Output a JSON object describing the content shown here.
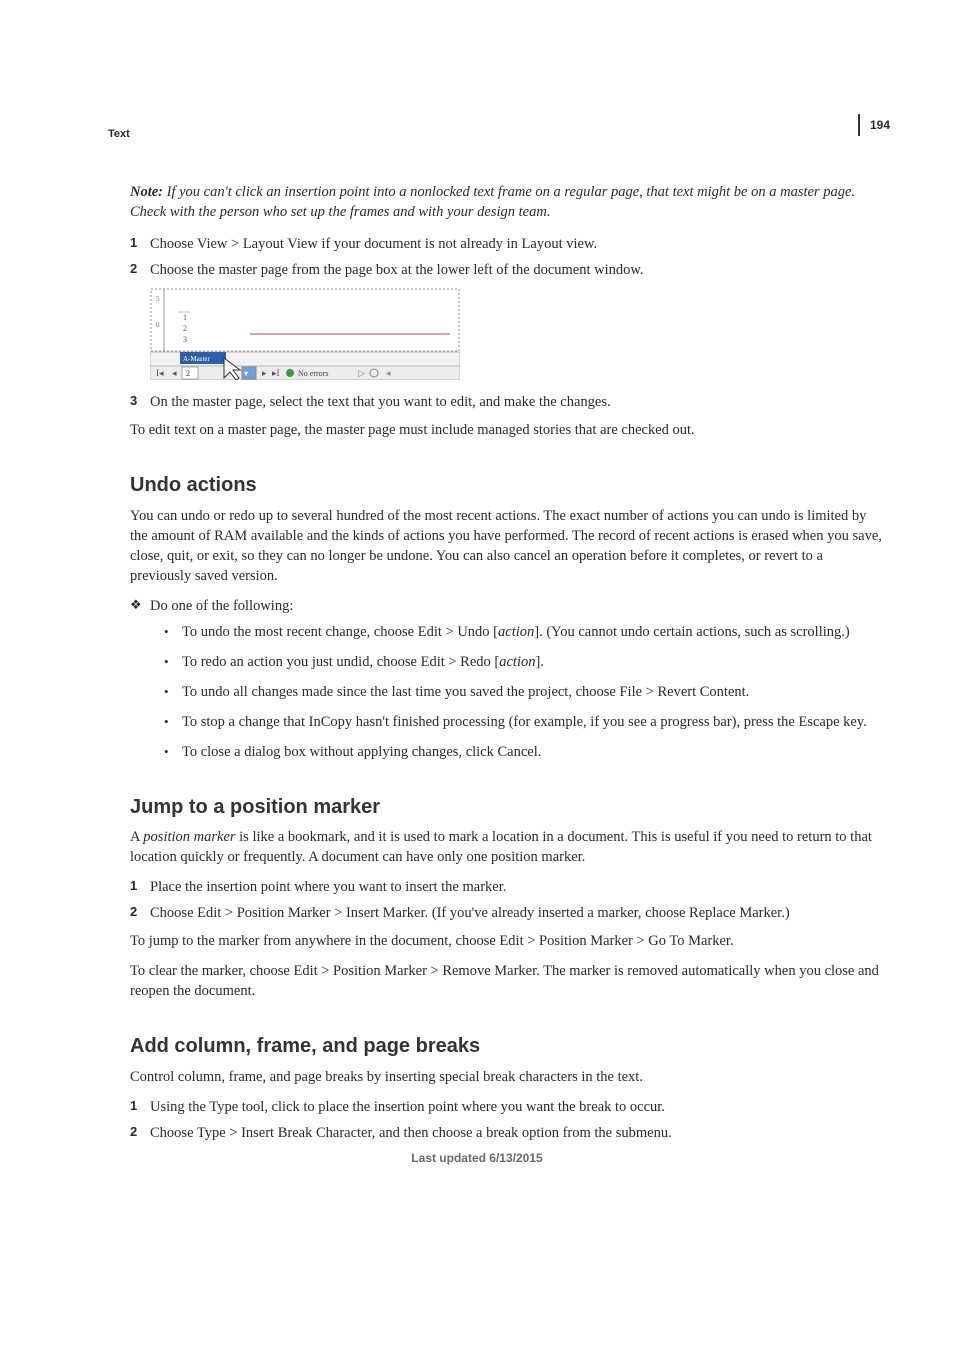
{
  "header_label": "Text",
  "page_number": "194",
  "note_prefix": "Note:",
  "note_body": " If you can't click an insertion point into a nonlocked text frame on a regular page, that text might be on a master page. Check with the person who set up the frames and with your design team.",
  "top_steps": [
    "Choose View > Layout View if your document is not already in Layout view.",
    "Choose the master page from the page box at the lower left of the document window."
  ],
  "figure": {
    "rows": [
      "1",
      "2",
      "3"
    ],
    "tab_label": "A-Master",
    "page_field": "2",
    "status": "No errors"
  },
  "step3": "On the master page, select the text that you want to edit, and make the changes.",
  "master_edit_note": "To edit text on a master page, the master page must include managed stories that are checked out.",
  "undo": {
    "title": "Undo actions",
    "body": "You can undo or redo up to several hundred of the most recent actions. The exact number of actions you can undo is limited by the amount of RAM available and the kinds of actions you have performed. The record of recent actions is erased when you save, close, quit, or exit, so they can no longer be undone. You can also cancel an operation before it completes, or revert to a previously saved version.",
    "do_one": "Do one of the following:",
    "items": {
      "a_pre": "To undo the most recent change, choose Edit > Undo [",
      "a_em": "action",
      "a_post": "]. (You cannot undo certain actions, such as scrolling.)",
      "b_pre": "To redo an action you just undid, choose Edit > Redo [",
      "b_em": "action",
      "b_post": "].",
      "c": "To undo all changes made since the last time you saved the project, choose File > Revert Content.",
      "d": "To stop a change that InCopy hasn't finished processing (for example, if you see a progress bar), press the Escape key.",
      "e": "To close a dialog box without applying changes, click Cancel."
    }
  },
  "jump": {
    "title": "Jump to a position marker",
    "body_pre": "A ",
    "body_em": "position marker",
    "body_post": " is like a bookmark, and it is used to mark a location in a document. This is useful if you need to return to that location quickly or frequently. A document can have only one position marker.",
    "steps": [
      "Place the insertion point where you want to insert the marker.",
      "Choose Edit > Position Marker > Insert Marker. (If you've already inserted a marker, choose Replace Marker.)"
    ],
    "after1": "To jump to the marker from anywhere in the document, choose Edit > Position Marker > Go To Marker.",
    "after2": "To clear the marker, choose Edit > Position Marker > Remove Marker. The marker is removed automatically when you close and reopen the document."
  },
  "breaks": {
    "title": "Add column, frame, and page breaks",
    "body": "Control column, frame, and page breaks by inserting special break characters in the text.",
    "steps": [
      "Using the Type tool, click to place the insertion point where you want the break to occur.",
      "Choose Type > Insert Break Character, and then choose a break option from the submenu."
    ]
  },
  "footer": "Last updated 6/13/2015"
}
